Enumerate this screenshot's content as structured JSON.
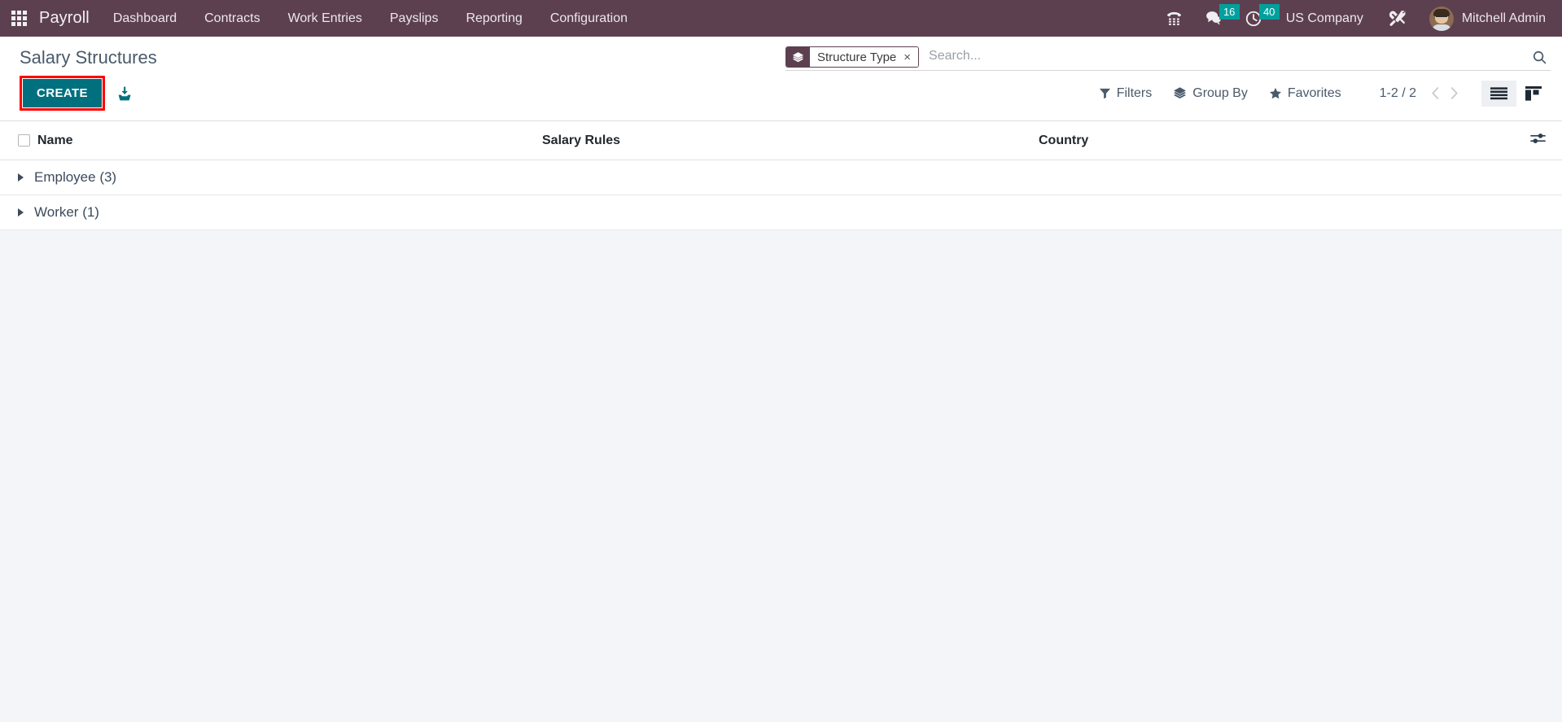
{
  "navbar": {
    "apps_icon": "apps-grid-icon",
    "brand": "Payroll",
    "menu_items": [
      {
        "label": "Dashboard"
      },
      {
        "label": "Contracts"
      },
      {
        "label": "Work Entries"
      },
      {
        "label": "Payslips"
      },
      {
        "label": "Reporting"
      },
      {
        "label": "Configuration"
      }
    ],
    "systray": {
      "phone_icon": "dialpad-phone-icon",
      "messages_icon": "chat-bubble-icon",
      "messages_count": "16",
      "activities_icon": "clock-icon",
      "activities_count": "40",
      "company": "US Company",
      "tools_icon": "wrench-screwdriver-icon",
      "avatar": "user-avatar",
      "username": "Mitchell Admin"
    },
    "colors": {
      "background": "#5C4050",
      "badge": "#00A09D",
      "text": "#EDE7EC"
    }
  },
  "control_panel": {
    "title": "Salary Structures",
    "create_label": "CREATE",
    "create_color": "#00707F",
    "highlight_color": "#FF0000",
    "import_icon": "import-download-icon",
    "search": {
      "facet_icon": "layers-icon",
      "facet_label": "Structure Type",
      "facet_close": "×",
      "placeholder": "Search...",
      "value": "",
      "search_icon": "search-magnifier-icon"
    },
    "buttons": [
      {
        "label": "Filters",
        "icon": "filter-funnel-icon"
      },
      {
        "label": "Group By",
        "icon": "layers-icon"
      },
      {
        "label": "Favorites",
        "icon": "star-icon"
      }
    ],
    "pager": {
      "range": "1-2 / 2",
      "prev_icon": "chevron-left-icon",
      "next_icon": "chevron-right-icon"
    },
    "views": [
      {
        "name": "list",
        "icon": "list-view-icon",
        "active": true
      },
      {
        "name": "kanban",
        "icon": "kanban-view-icon",
        "active": false
      }
    ]
  },
  "list": {
    "columns": {
      "name": "Name",
      "salary_rules": "Salary Rules",
      "country": "Country"
    },
    "optional_columns_icon": "sliders-toggle-icon",
    "select_all_checkbox": false,
    "groups": [
      {
        "label": "Employee (3)",
        "expanded": false
      },
      {
        "label": "Worker (1)",
        "expanded": false
      }
    ]
  }
}
